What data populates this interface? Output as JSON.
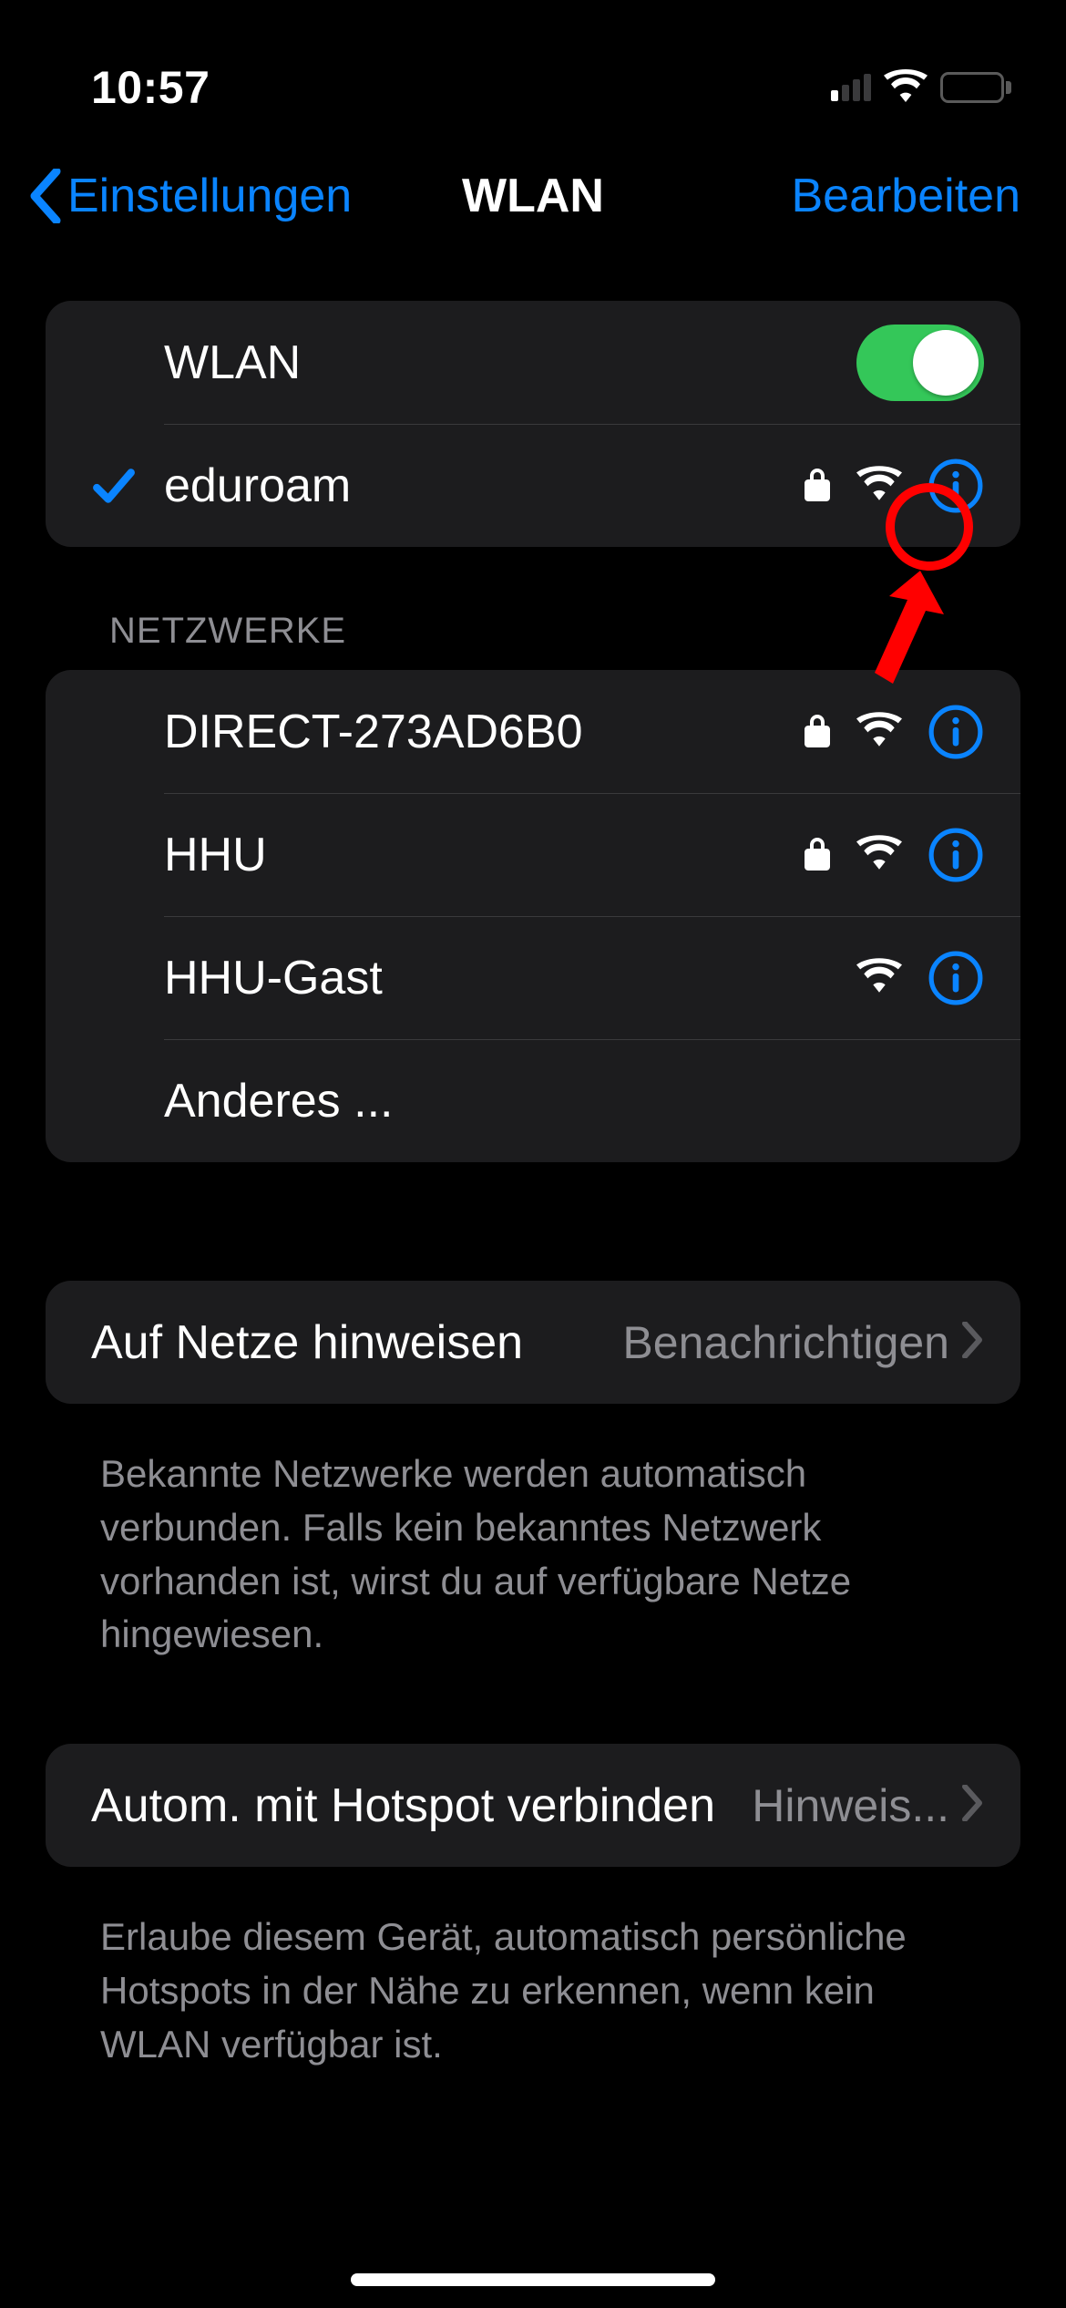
{
  "status": {
    "time": "10:57"
  },
  "nav": {
    "back_label": "Einstellungen",
    "title": "WLAN",
    "edit_label": "Bearbeiten"
  },
  "wlan": {
    "toggle_label": "WLAN",
    "toggle_on": true,
    "connected": {
      "name": "eduroam",
      "locked": true
    }
  },
  "networks": {
    "header": "Netzwerke",
    "items": [
      {
        "name": "DIRECT-273AD6B0",
        "locked": true
      },
      {
        "name": "HHU",
        "locked": true
      },
      {
        "name": "HHU-Gast",
        "locked": false
      }
    ],
    "other_label": "Anderes ..."
  },
  "ask": {
    "label": "Auf Netze hinweisen",
    "value": "Benachrichtigen",
    "footer": "Bekannte Netzwerke werden automatisch verbunden. Falls kein bekanntes Netzwerk vorhanden ist, wirst du auf verfügbare Netze hingewiesen."
  },
  "hotspot": {
    "label": "Autom. mit Hotspot verbinden",
    "value": "Hinweis...",
    "footer": "Erlaube diesem Gerät, automatisch persönliche Hotspots in der Nähe zu erkennen, wenn kein WLAN verfügbar ist."
  },
  "colors": {
    "accent": "#0a84ff"
  }
}
